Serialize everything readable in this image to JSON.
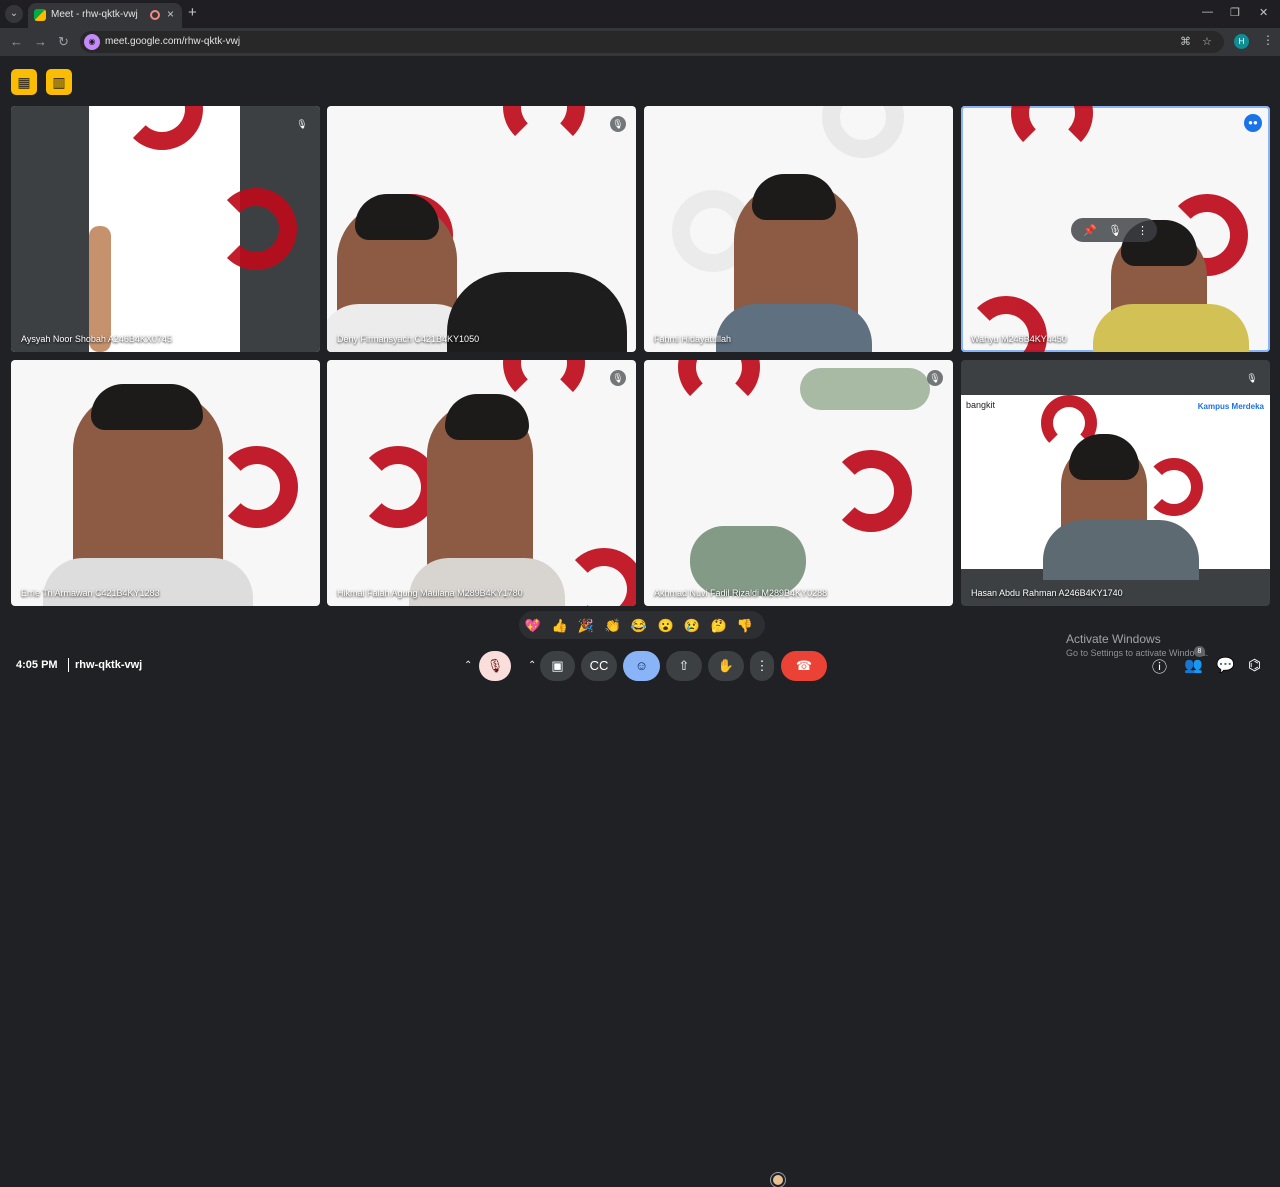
{
  "browser": {
    "tab_title": "Meet - rhw-qktk-vwj",
    "url": "meet.google.com/rhw-qktk-vwj",
    "profile_initial": "H"
  },
  "meeting": {
    "time": "4:05 PM",
    "code": "rhw-qktk-vwj",
    "participant_count": "8"
  },
  "participants": [
    {
      "name": "Aysyah Noor Shobah A246B4KX0745",
      "muted": true
    },
    {
      "name": "Deny Firmansyach C421B4KY1050",
      "muted": true
    },
    {
      "name": "Fahmi Hidayatullah",
      "muted": false
    },
    {
      "name": "Wahyu M246B4KY4450",
      "muted": false,
      "speaking": true
    },
    {
      "name": "Errie Tri Armawan C421B4KY1283",
      "muted": false
    },
    {
      "name": "Hikmal Falah Agung Maulana M289B4KY1780",
      "muted": true
    },
    {
      "name": "Akhmad Nuvi Fadil Rizaldi M289B4KY0288",
      "muted": true
    },
    {
      "name": "Hasan Abdu Rahman A246B4KY1740",
      "muted": true
    }
  ],
  "tile_logo": {
    "brand": "bangkit",
    "partner": "Kampus Merdeka"
  },
  "reactions": [
    "💖",
    "👍",
    "🎉",
    "👏",
    "😂",
    "😮",
    "😢",
    "🤔",
    "👎"
  ],
  "windows_watermark": {
    "title": "Activate Windows",
    "subtitle": "Go to Settings to activate Windows."
  },
  "colors": {
    "accent": "#8ab4f8",
    "leave": "#ea4335",
    "brand_red": "#bd0b1b"
  }
}
